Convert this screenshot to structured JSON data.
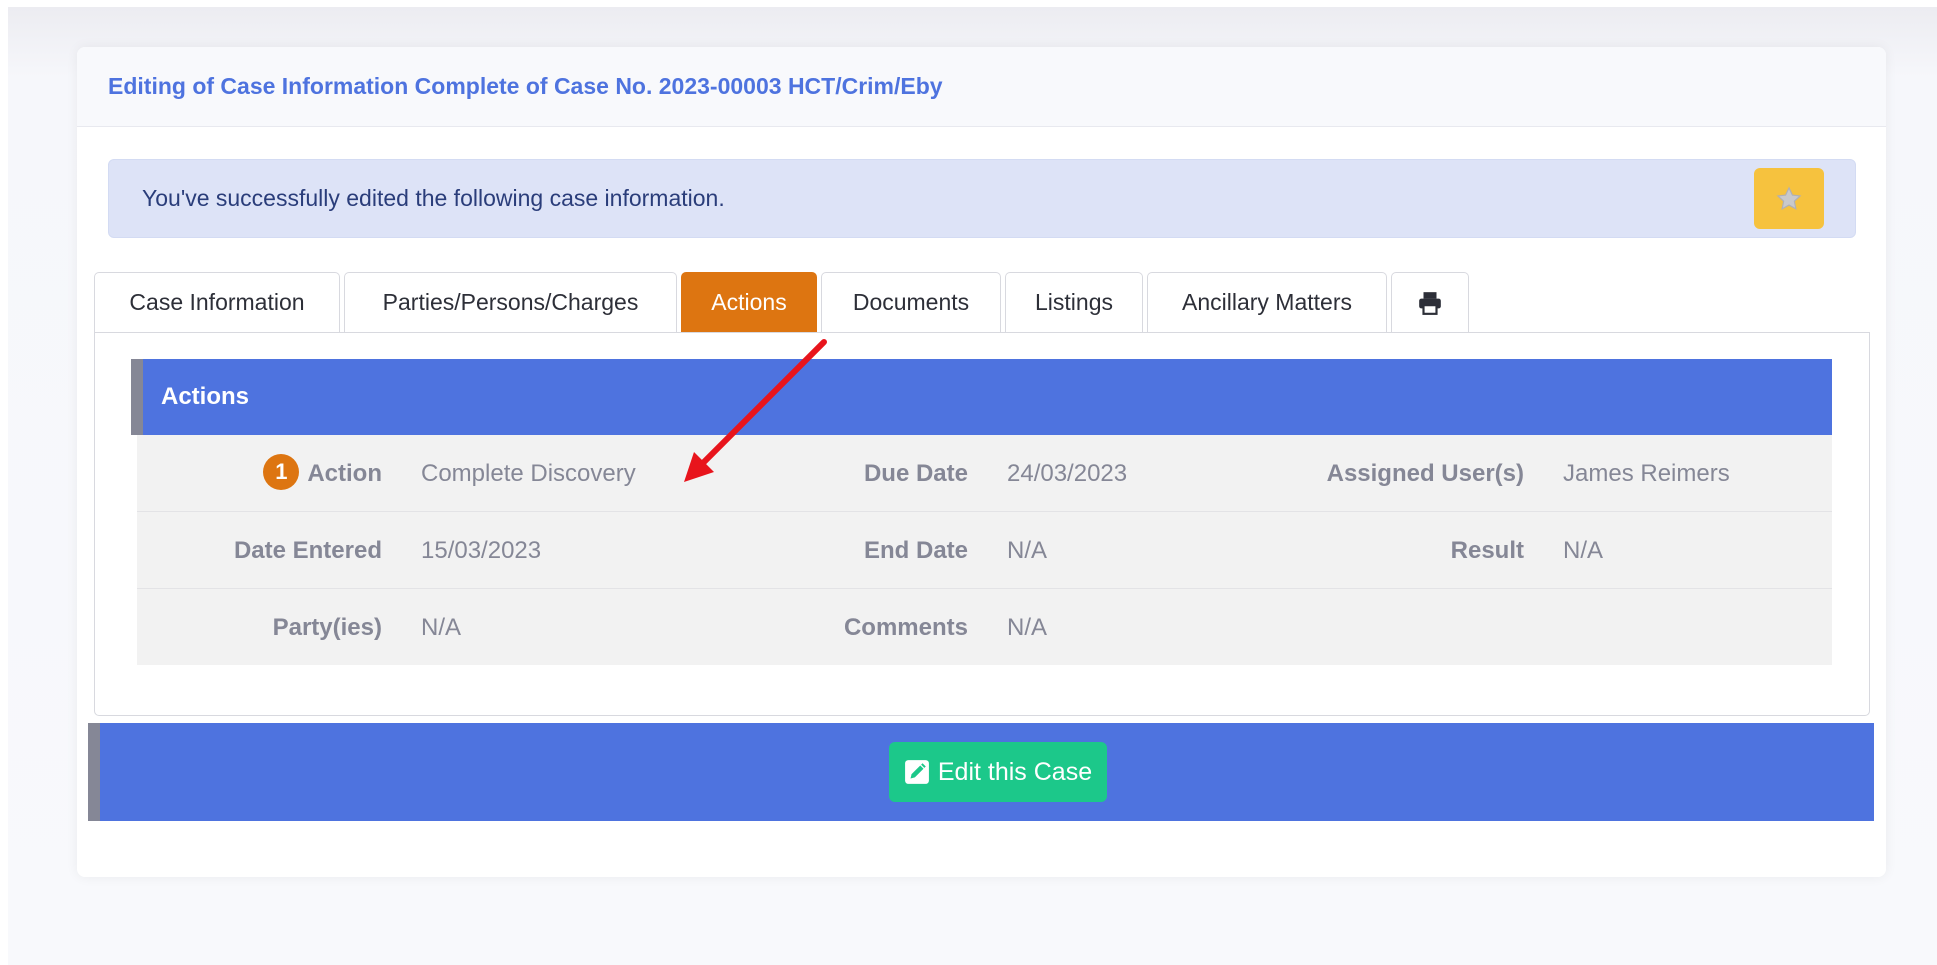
{
  "header": {
    "title": "Editing of Case Information Complete of Case No. 2023-00003 HCT/Crim/Eby"
  },
  "alert": {
    "message": "You've successfully edited the following case information.",
    "icon": "star-icon"
  },
  "tabs": [
    {
      "label": "Case Information",
      "active": false
    },
    {
      "label": "Parties/Persons/Charges",
      "active": false
    },
    {
      "label": "Actions",
      "active": true
    },
    {
      "label": "Documents",
      "active": false
    },
    {
      "label": "Listings",
      "active": false
    },
    {
      "label": "Ancillary Matters",
      "active": false
    },
    {
      "label": "",
      "icon": "print-icon",
      "active": false
    }
  ],
  "section": {
    "title": "Actions"
  },
  "action": {
    "number": "1",
    "action_label": "Action",
    "action_value": "Complete Discovery",
    "due_date_label": "Due Date",
    "due_date_value": "24/03/2023",
    "assigned_label": "Assigned User(s)",
    "assigned_value": "James Reimers",
    "date_entered_label": "Date Entered",
    "date_entered_value": "15/03/2023",
    "end_date_label": "End Date",
    "end_date_value": "N/A",
    "result_label": "Result",
    "result_value": "N/A",
    "parties_label": "Party(ies)",
    "parties_value": "N/A",
    "comments_label": "Comments",
    "comments_value": "N/A"
  },
  "footer": {
    "edit_label": "Edit this Case",
    "edit_icon": "edit-icon"
  },
  "colors": {
    "primary": "#4e73df",
    "warning": "#f6c23e",
    "active_tab": "#dd7511",
    "success": "#1cc88a",
    "arrow": "#e8141c"
  }
}
